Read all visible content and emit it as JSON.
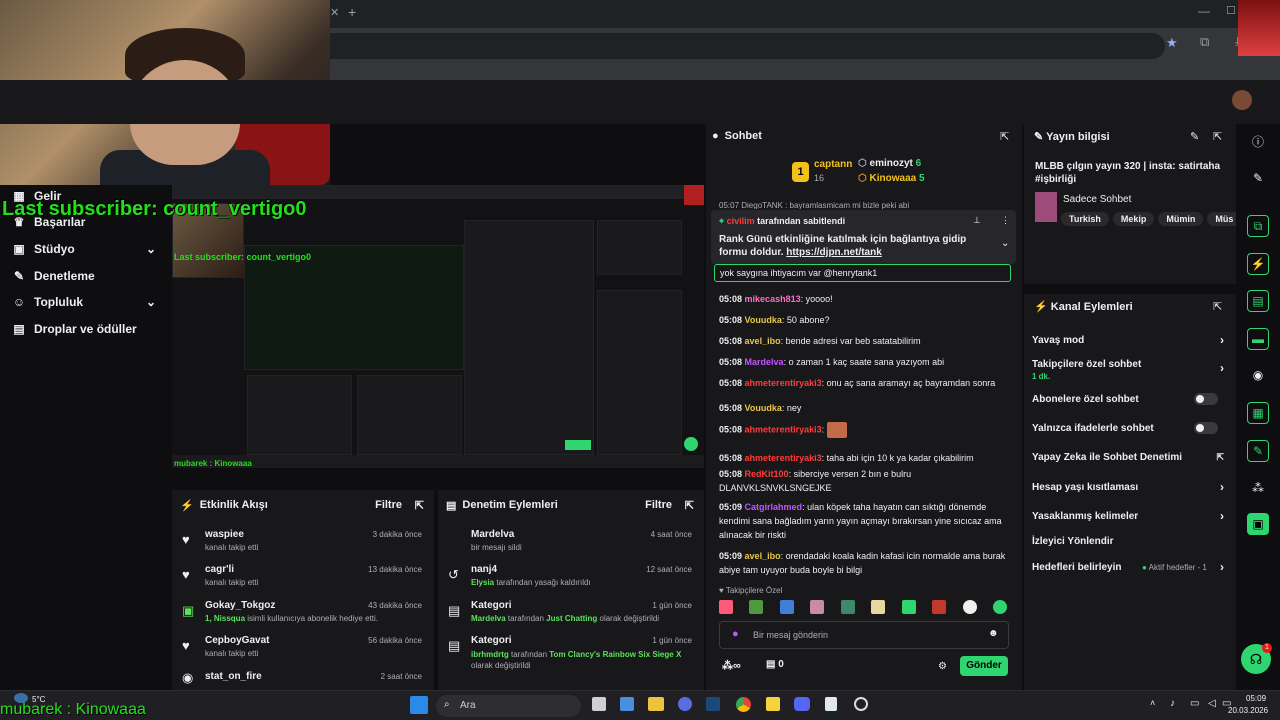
{
  "header": {
    "avatar_present": true
  },
  "overlay": {
    "last_subscriber": "Last subscriber: count_vertigo0",
    "small_last_subscriber": "Last subscriber: count_vertigo0",
    "bottom_left_text": "mubarek : Kinowaaa",
    "nested_bottom_text": "mubarek : Kinowaaa"
  },
  "nav": {
    "items": [
      {
        "icon": "home-icon",
        "label": "Gelir"
      },
      {
        "icon": "trophy-icon",
        "label": "Başarılar"
      },
      {
        "icon": "video-icon",
        "label": "Stüdyo"
      },
      {
        "icon": "wrench-icon",
        "label": "Denetleme"
      },
      {
        "icon": "community-icon",
        "label": "Topluluk"
      },
      {
        "icon": "gift-icon",
        "label": "Droplar ve ödüller"
      }
    ]
  },
  "activity": {
    "title": "Etkinlik Akışı",
    "filter": "Filtre",
    "rows": [
      {
        "icon": "heart-icon",
        "name": "waspiee",
        "sub": "kanalı takip etti",
        "time": "3 dakika önce"
      },
      {
        "icon": "heart-icon",
        "name": "cagr'li",
        "sub": "kanalı takip etti",
        "time": "13 dakika önce"
      },
      {
        "icon": "gift-icon",
        "name": "Gokay_Tokgoz",
        "sub_highlight": "1, Nissqua",
        "sub": " isimli kullanıcıya abonelik hediye etti.",
        "time": "43 dakika önce"
      },
      {
        "icon": "heart-icon",
        "name": "CepboyGavat",
        "sub": "kanalı takip etti",
        "time": "56 dakika önce"
      },
      {
        "icon": "raid-icon",
        "name": "stat_on_fire",
        "sub": "",
        "time": "2 saat önce"
      }
    ]
  },
  "moderation": {
    "title": "Denetim Eylemleri",
    "filter": "Filtre",
    "rows": [
      {
        "icon": "user-icon",
        "name": "Mardelva",
        "sub": "bir mesajı sildi",
        "time": "4 saat önce"
      },
      {
        "icon": "undo-icon",
        "name": "nanj4",
        "sub_highlight": "Elysia",
        "sub": " tarafından yasağı kaldırıldı",
        "time": "12 saat önce"
      },
      {
        "icon": "category-icon",
        "name": "Kategori",
        "sub_highlight": "Mardelva",
        "sub": " tarafından ",
        "sub_highlight2": "Just Chatting",
        "sub2": " olarak değiştirildi",
        "time": "1 gün önce"
      },
      {
        "icon": "category-icon",
        "name": "Kategori",
        "sub_highlight": "ibrhmdrtg",
        "sub": " tarafından ",
        "sub_highlight2": "Tom Clancy's Rainbow Six Siege X",
        "sub2": " olarak değiştirildi",
        "time": "1 gün önce"
      }
    ]
  },
  "chat": {
    "title": "Sohbet",
    "leaders": [
      {
        "rank": "1",
        "name": "captann",
        "count": "16"
      },
      {
        "rank": "",
        "name": "eminozyt",
        "count": "6"
      },
      {
        "rank": "",
        "name": "Kinowaaa",
        "count": "5"
      }
    ],
    "partial_top": "05:07 DiegoTANK : bayramlasmicam mi bizle peki abi",
    "pinned_by_user": "civilim",
    "pinned_by_suffix": "tarafından sabitlendi",
    "pinned_text": "Rank Günü etkinliğine katılmak için bağlantıya gidip formu doldur.",
    "pinned_link": "https://djpn.net/tank",
    "reply_text": "yok saygına ihtiyacım var @henrytank1",
    "messages": [
      {
        "time": "05:08",
        "user": "mikecash813",
        "color": "#ff6ec7",
        "text": "yoooo!"
      },
      {
        "time": "05:08",
        "user": "Vouudka",
        "color": "#e8c54a",
        "text": "50 abone?"
      },
      {
        "time": "05:08",
        "user": "avel_ibo",
        "color": "#e8c54a",
        "text": "bende adresi var beb satatabilirim"
      },
      {
        "time": "05:08",
        "user": "Mardelva",
        "color": "#c255ff",
        "text": "o zaman 1 kaç saate sana yazıyom abi"
      },
      {
        "time": "05:08",
        "user": "ahmeterentiryaki3",
        "color": "#ff3b3b",
        "text": "onu aç sana aramayı aç bayramdan sonra"
      },
      {
        "time": "05:08",
        "user": "Vouudka",
        "color": "#e8c54a",
        "text": "ney"
      },
      {
        "time": "05:08",
        "user": "ahmeterentiryaki3",
        "color": "#ff3b3b",
        "text": ""
      },
      {
        "time": "05:08",
        "user": "ahmeterentiryaki3",
        "color": "#ff3b3b",
        "text": "taha abi için 10 k ya kadar çıkabilirim"
      },
      {
        "time": "05:08",
        "user": "RedKit100",
        "color": "#ff3b3b",
        "text": "siberciye versen 2 bın e bulru DLANVKLSNVKLSNGEJKE"
      },
      {
        "time": "05:09",
        "user": "Catgirlahmed",
        "color": "#c255ff",
        "text": "ulan köpek taha hayatın can sıktığı dönemde kendimi sana bağladım yarın yayın açmayı bırakırsan yine sıcıcaz ama alınacak bir riskti"
      },
      {
        "time": "05:09",
        "user": "avel_ibo",
        "color": "#e8c54a",
        "text": "orendadaki koala kadin kafasi icin normalde ama burak abiye tam uyuyor buda boyle bi bilgi"
      }
    ],
    "followers_only": "Takipçilere Özel",
    "input_placeholder": "Bir mesaj gönderin",
    "points": "0",
    "send": "Gönder"
  },
  "stream_info": {
    "title": "Yayın bilgisi",
    "stream_title": "MLBB çılgın yayın 320 | insta: satirtaha #işbirliği",
    "category": "Sadece Sohbet",
    "tags": [
      "Turkish",
      "Mekip",
      "Mümin",
      "Müs"
    ]
  },
  "channel_actions": {
    "title": "Kanal Eylemleri",
    "rows": [
      {
        "label": "Yavaş mod",
        "kind": "chevron"
      },
      {
        "label": "Takipçilere özel sohbet",
        "sub": "1 dk.",
        "kind": "chevron"
      },
      {
        "label": "Abonelere özel sohbet",
        "kind": "toggle"
      },
      {
        "label": "Yalnızca ifadelerle sohbet",
        "kind": "toggle"
      },
      {
        "label": "Yapay Zeka ile Sohbet Denetimi",
        "kind": "external"
      },
      {
        "label": "Hesap yaşı kısıtlaması",
        "kind": "chevron"
      },
      {
        "label": "Yasaklanmış kelimeler",
        "kind": "chevron"
      },
      {
        "label": "İzleyici Yönlendir",
        "kind": "none"
      },
      {
        "label": "Hedefleri belirleyin",
        "kind": "goal",
        "goal": "Aktif hedefler - 1"
      }
    ]
  },
  "taskbar": {
    "weather": "5°C",
    "search": "Ara",
    "time": "05:09",
    "date": "20.03.2026"
  },
  "colors": {
    "accent": "#2fd670",
    "bg": "#0e0e10",
    "panel": "#18181b"
  }
}
